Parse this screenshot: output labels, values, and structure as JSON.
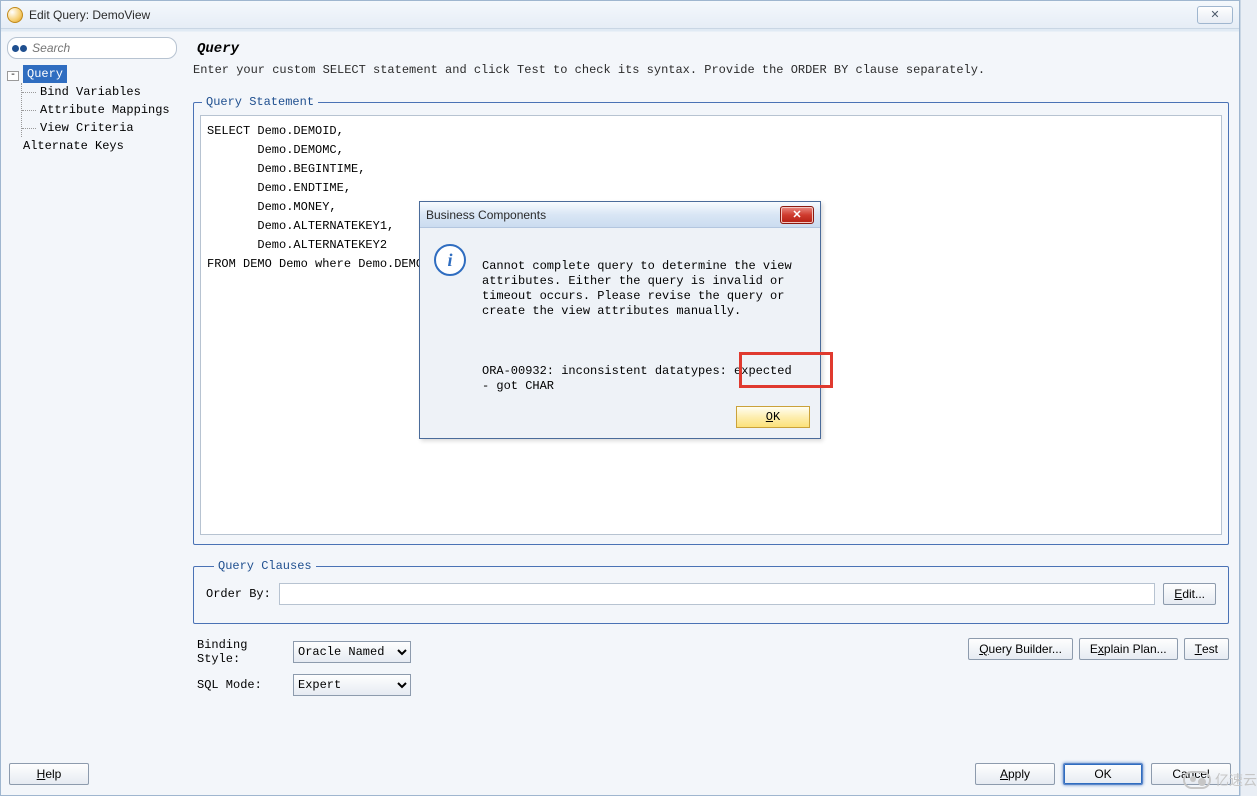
{
  "window": {
    "title": "Edit Query: DemoView",
    "close_glyph": "✕"
  },
  "sidebar": {
    "search_placeholder": "Search",
    "root_label": "Query",
    "expand_glyph": "-",
    "children": [
      "Bind Variables",
      "Attribute Mappings",
      "View Criteria"
    ],
    "alt_label": "Alternate Keys"
  },
  "main": {
    "heading": "Query",
    "instruction": "Enter your custom SELECT statement and click Test to check its syntax.  Provide the ORDER BY clause separately.",
    "query_legend": "Query Statement",
    "sql_text": "SELECT Demo.DEMOID, \n       Demo.DEMOMC, \n       Demo.BEGINTIME, \n       Demo.ENDTIME, \n       Demo.MONEY, \n       Demo.ALTERNATEKEY1, \n       Demo.ALTERNATEKEY2\nFROM DEMO Demo where Demo.DEMOMC in",
    "clauses_legend": "Query Clauses",
    "order_by_label": "Order By:",
    "order_by_value": "",
    "edit_btn": "Edit...",
    "binding_label": "Binding Style:",
    "binding_value": "Oracle Named",
    "sqlmode_label": "SQL Mode:",
    "sqlmode_value": "Expert",
    "query_builder_btn": "Query Builder...",
    "explain_plan_btn": "Explain Plan...",
    "test_btn": "Test"
  },
  "buttons": {
    "help": "Help",
    "apply": "Apply",
    "ok": "OK",
    "cancel": "Cancel"
  },
  "dialog": {
    "title": "Business Components",
    "close_glyph": "✕",
    "info_glyph": "i",
    "message_main": "Cannot complete query to determine the view attributes.  Either the query is invalid or timeout occurs.  Please revise the query or create the view attributes manually.",
    "message_error": "ORA-00932: inconsistent datatypes: expected - got CHAR",
    "ok_btn": "OK"
  },
  "watermark": "亿速云"
}
